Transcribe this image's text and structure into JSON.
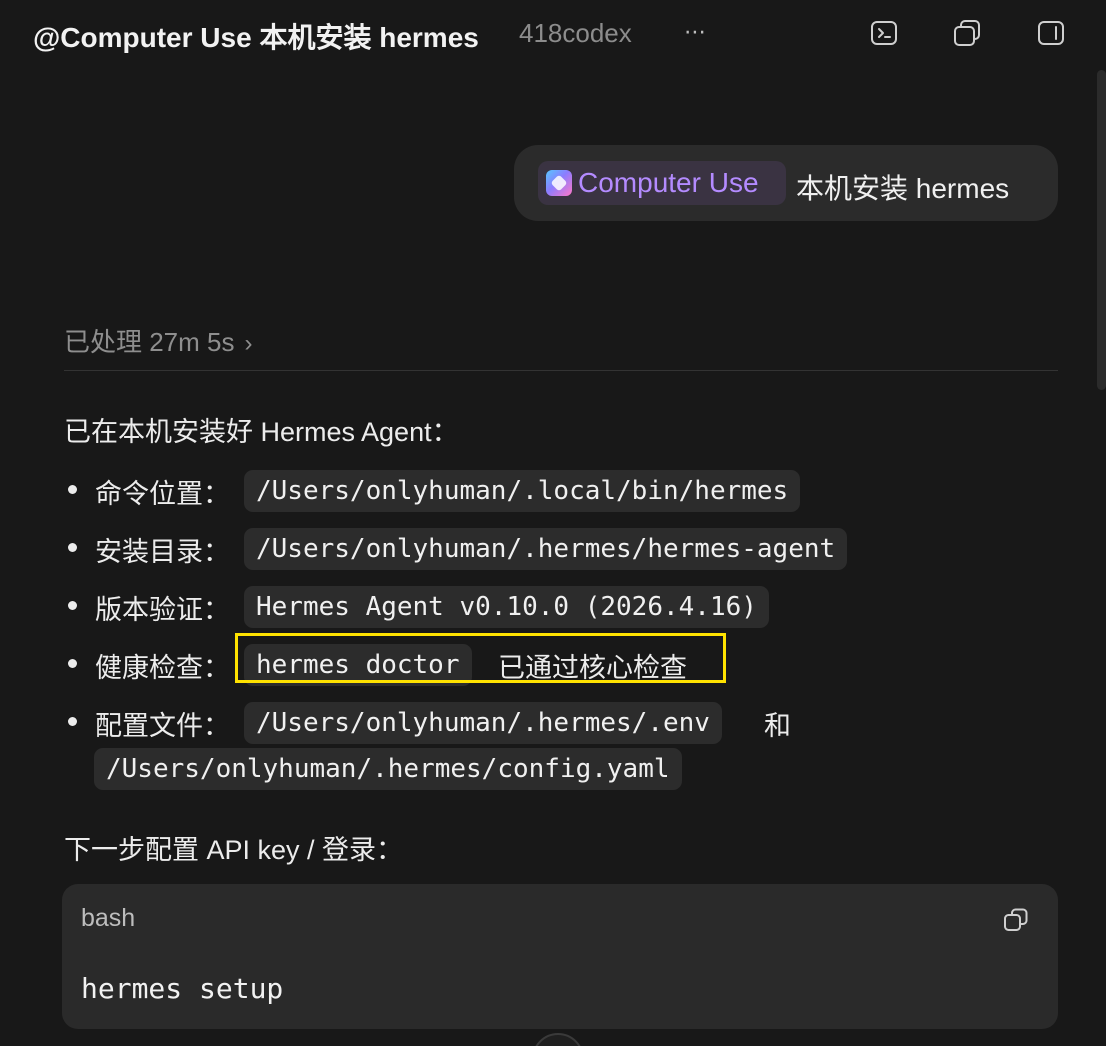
{
  "header": {
    "title": "@Computer Use 本机安装 hermes",
    "project": "418codex",
    "more_label": "⋯",
    "icons": [
      "terminal-icon",
      "copy-windows-icon",
      "sidebar-toggle-icon"
    ]
  },
  "user_message": {
    "mention": "Computer Use",
    "text": "本机安装 hermes"
  },
  "processed": {
    "label": "已处理 27m 5s",
    "chevron": "›"
  },
  "response": {
    "intro": "已在本机安装好 Hermes Agent：",
    "items": [
      {
        "label": "命令位置：",
        "code": "/Users/onlyhuman/.local/bin/hermes"
      },
      {
        "label": "安装目录：",
        "code": "/Users/onlyhuman/.hermes/hermes-agent"
      },
      {
        "label": "版本验证：",
        "code": "Hermes Agent v0.10.0 (2026.4.16)"
      },
      {
        "label": "健康检查：",
        "code": "hermes doctor",
        "suffix": "已通过核心检查"
      },
      {
        "label": "配置文件：",
        "code": "/Users/onlyhuman/.hermes/.env",
        "joiner": "和",
        "code2": "/Users/onlyhuman/.hermes/config.yaml"
      }
    ],
    "next_step": "下一步配置 API key / 登录："
  },
  "code_block": {
    "language": "bash",
    "content": "hermes setup"
  },
  "colors": {
    "background": "#181818",
    "mention_accent": "#b48bff",
    "highlight": "#ffe200"
  }
}
